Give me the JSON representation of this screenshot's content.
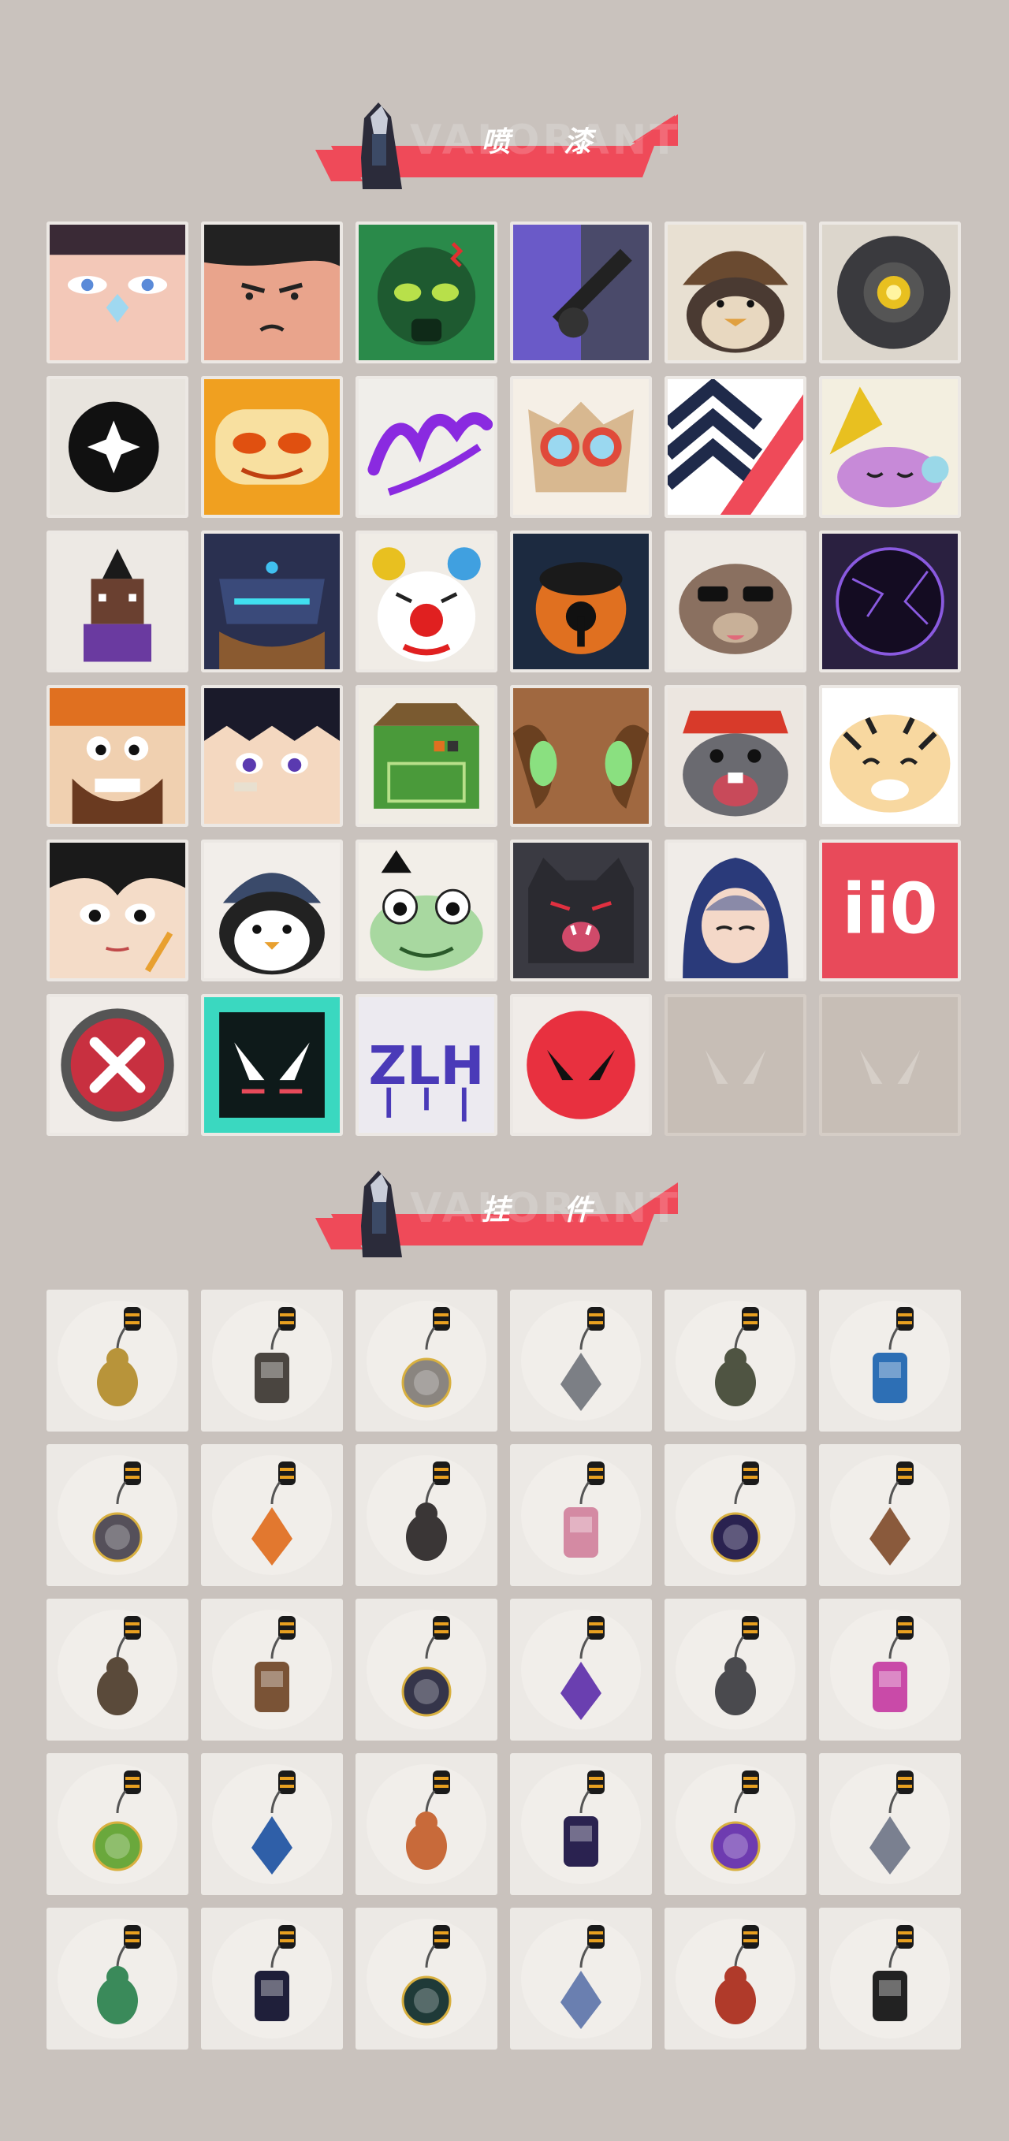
{
  "sections": {
    "sprays": {
      "title": "喷 漆"
    },
    "charms": {
      "title": "挂 件"
    }
  },
  "banner_watermark": "VALORANT",
  "colors": {
    "background": "#c9c2bd",
    "banner_red": "#ef4a59",
    "tile_border": "#ece8e4",
    "tile_empty": "#c7beb6"
  },
  "sprays": [
    {
      "icon": "spray-face-butterfly-nose-icon"
    },
    {
      "icon": "spray-angry-boy-icon"
    },
    {
      "icon": "spray-green-gasmask-icon"
    },
    {
      "icon": "spray-purple-rifle-icon"
    },
    {
      "icon": "spray-penguin-beanie-icon"
    },
    {
      "icon": "spray-camera-robot-icon"
    },
    {
      "icon": "spray-black-star-icon"
    },
    {
      "icon": "spray-orange-mask-icon"
    },
    {
      "icon": "spray-purple-graffiti-icon"
    },
    {
      "icon": "spray-goggles-cat-icon"
    },
    {
      "icon": "spray-chevron-stripes-icon"
    },
    {
      "icon": "spray-sleepy-creature-icon"
    },
    {
      "icon": "spray-pixel-agent-icon"
    },
    {
      "icon": "spray-armored-robot-icon"
    },
    {
      "icon": "spray-clown-icon"
    },
    {
      "icon": "spray-orange-orb-icon"
    },
    {
      "icon": "spray-raccoon-sunglasses-icon"
    },
    {
      "icon": "spray-dark-portal-icon"
    },
    {
      "icon": "spray-bearded-grin-icon"
    },
    {
      "icon": "spray-anime-boy-icon"
    },
    {
      "icon": "spray-green-crate-icon"
    },
    {
      "icon": "spray-green-eyes-icon"
    },
    {
      "icon": "spray-crying-mole-icon"
    },
    {
      "icon": "spray-tiger-icon"
    },
    {
      "icon": "spray-girl-pencil-icon"
    },
    {
      "icon": "spray-penguin-hat-icon"
    },
    {
      "icon": "spray-frog-icon"
    },
    {
      "icon": "spray-dark-cat-icon"
    },
    {
      "icon": "spray-hooded-girl-icon"
    },
    {
      "icon": "spray-ii0-text-icon"
    },
    {
      "icon": "spray-red-x-icon"
    },
    {
      "icon": "spray-valorant-teal-icon"
    },
    {
      "icon": "spray-purple-drip-graffiti-icon"
    },
    {
      "icon": "spray-red-valorant-circle-icon"
    },
    {
      "icon": "empty-slot-valorant-icon"
    },
    {
      "icon": "empty-slot-valorant-icon"
    }
  ],
  "charms": [
    {
      "icon": "charm-gold-frog-icon",
      "color": "#b8943a"
    },
    {
      "icon": "charm-drone-icon",
      "color": "#4a4540"
    },
    {
      "icon": "charm-shopping-cart-icon",
      "color": "#8a8580"
    },
    {
      "icon": "charm-armored-figure-icon",
      "color": "#7c7f85"
    },
    {
      "icon": "charm-green-bag-icon",
      "color": "#4f5442"
    },
    {
      "icon": "charm-blue-bottle-icon",
      "color": "#2d6fb5"
    },
    {
      "icon": "charm-red-sword-icon",
      "color": "#55505a"
    },
    {
      "icon": "charm-orange-bird-icon",
      "color": "#e2782f"
    },
    {
      "icon": "charm-black-rope-icon",
      "color": "#3a3636"
    },
    {
      "icon": "charm-cupcake-icon",
      "color": "#d48aa3"
    },
    {
      "icon": "charm-ep9-purple-medal-icon",
      "color": "#2a2250"
    },
    {
      "icon": "charm-teddy-bear-icon",
      "color": "#8a5a3c"
    },
    {
      "icon": "charm-pistol-icon",
      "color": "#5a4a3a"
    },
    {
      "icon": "charm-wooden-box-icon",
      "color": "#7a5336"
    },
    {
      "icon": "charm-dark-figure-icon",
      "color": "#35354a"
    },
    {
      "icon": "charm-purple-crystal-icon",
      "color": "#6a3fb0"
    },
    {
      "icon": "charm-dark-dragon-icon",
      "color": "#4a4a4e"
    },
    {
      "icon": "charm-lava-lamp-icon",
      "color": "#c94aa8"
    },
    {
      "icon": "charm-green-pager-icon",
      "color": "#6aa83c"
    },
    {
      "icon": "charm-blue-astronaut-icon",
      "color": "#2f5fa8"
    },
    {
      "icon": "charm-orange-radio-icon",
      "color": "#c86a3a"
    },
    {
      "icon": "charm-ep9-navy-medal-icon",
      "color": "#2a2250"
    },
    {
      "icon": "charm-purple-heart-icon",
      "color": "#6e3bb0"
    },
    {
      "icon": "charm-agent-tag-icon",
      "color": "#7a8090"
    },
    {
      "icon": "charm-green-can-icon",
      "color": "#3a8a5a"
    },
    {
      "icon": "charm-ep9-gold-medal-icon",
      "color": "#1f1f3a"
    },
    {
      "icon": "charm-ep8-teal-medal-icon",
      "color": "#1f3a38"
    },
    {
      "icon": "charm-ufo-icon",
      "color": "#6a7fb0"
    },
    {
      "icon": "charm-red-guitar-icon",
      "color": "#b03a2a"
    },
    {
      "icon": "charm-valorant-medal-icon",
      "color": "#222222"
    }
  ]
}
